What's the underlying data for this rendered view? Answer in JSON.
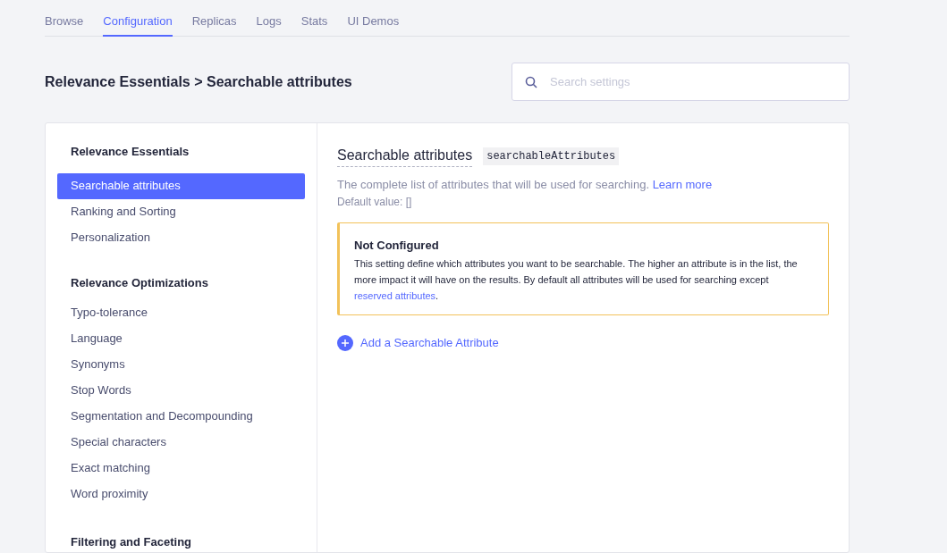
{
  "tabs": [
    {
      "label": "Browse",
      "selected": false
    },
    {
      "label": "Configuration",
      "selected": true
    },
    {
      "label": "Replicas",
      "selected": false
    },
    {
      "label": "Logs",
      "selected": false
    },
    {
      "label": "Stats",
      "selected": false
    },
    {
      "label": "UI Demos",
      "selected": false
    }
  ],
  "breadcrumb": "Relevance Essentials > Searchable attributes",
  "search": {
    "placeholder": "Search settings"
  },
  "sidebar": {
    "sections": [
      {
        "heading": "Relevance Essentials",
        "items": [
          {
            "label": "Searchable attributes",
            "selected": true
          },
          {
            "label": "Ranking and Sorting",
            "selected": false
          },
          {
            "label": "Personalization",
            "selected": false
          }
        ]
      },
      {
        "heading": "Relevance Optimizations",
        "items": [
          {
            "label": "Typo-tolerance",
            "selected": false
          },
          {
            "label": "Language",
            "selected": false
          },
          {
            "label": "Synonyms",
            "selected": false
          },
          {
            "label": "Stop Words",
            "selected": false
          },
          {
            "label": "Segmentation and Decompounding",
            "selected": false
          },
          {
            "label": "Special characters",
            "selected": false
          },
          {
            "label": "Exact matching",
            "selected": false
          },
          {
            "label": "Word proximity",
            "selected": false
          }
        ]
      },
      {
        "heading": "Filtering and Faceting"
      }
    ]
  },
  "setting": {
    "title": "Searchable attributes",
    "code": "searchableAttributes",
    "description": "The complete list of attributes that will be used for searching.",
    "learn_more": "Learn more",
    "default_value": "Default value: []",
    "notice": {
      "title": "Not Configured",
      "body": "This setting define which attributes you want to be searchable. The higher an attribute is in the list, the more impact it will have on the results. By default all attributes will be used for searching except ",
      "link": "reserved attributes",
      "body_end": "."
    },
    "add_button": "Add a Searchable Attribute"
  }
}
